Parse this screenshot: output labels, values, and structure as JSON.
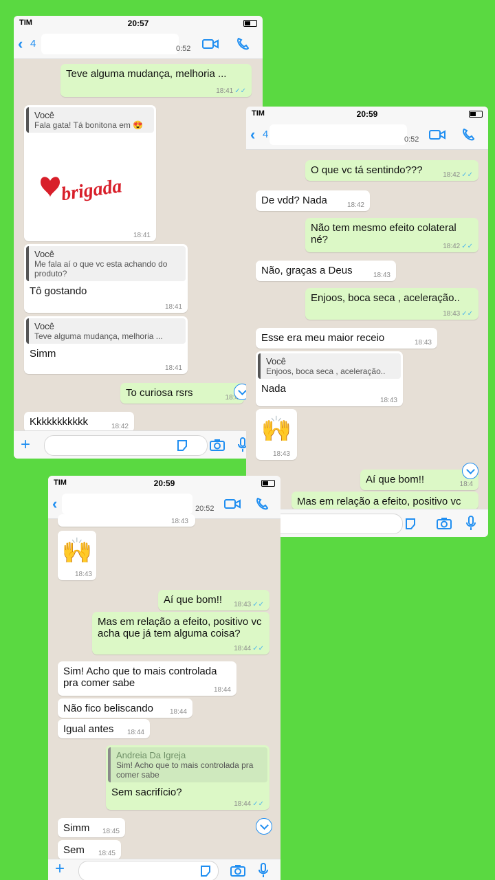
{
  "colors": {
    "background": "#5ad941",
    "outgoing": "#dcf8c6",
    "incoming": "#ffffff",
    "accent": "#1f8ef1"
  },
  "screen1": {
    "status": {
      "carrier": "TIM",
      "time": "20:57"
    },
    "header": {
      "back_count": "4",
      "last_seen": "0:52"
    },
    "messages": [
      {
        "text": "Teve alguma mudança, melhoria ...",
        "time": "18:41"
      },
      {
        "quote_name": "Você",
        "quote_text": "Fala gata! Tá bonitona em 😍",
        "sticker": "Obrigada",
        "time": "18:41"
      },
      {
        "quote_name": "Você",
        "quote_text": "Me fala aí o que vc esta achando do produto?",
        "text": "Tô gostando",
        "time": "18:41"
      },
      {
        "quote_name": "Você",
        "quote_text": "Teve alguma mudança, melhoria ...",
        "text": "Simm",
        "time": "18:41"
      },
      {
        "text": "To curiosa rsrs",
        "time": "18:4"
      },
      {
        "text": "Kkkkkkkkkkk",
        "time": "18:42"
      }
    ]
  },
  "screen2": {
    "status": {
      "carrier": "TIM",
      "time": "20:59"
    },
    "header": {
      "back_count": "4",
      "last_seen": "0:52"
    },
    "messages": [
      {
        "text": "O que vc tá sentindo???",
        "time": "18:42"
      },
      {
        "text": "De vdd? Nada",
        "time": "18:42"
      },
      {
        "text": "Não tem mesmo efeito colateral né?",
        "time": "18:42"
      },
      {
        "text": "Não, graças a Deus",
        "time": "18:43"
      },
      {
        "text": "Enjoos, boca seca , aceleração..",
        "time": "18:43"
      },
      {
        "text": "Esse era meu maior receio",
        "time": "18:43"
      },
      {
        "quote_name": "Você",
        "quote_text": "Enjoos, boca seca , aceleração..",
        "text": "Nada",
        "time": "18:43"
      },
      {
        "emoji": "🙌",
        "time": "18:43"
      },
      {
        "text": "Aí que bom!!",
        "time": "18:4"
      },
      {
        "text": "Mas em relação a efeito, positivo vc"
      }
    ]
  },
  "screen3": {
    "status": {
      "carrier": "TIM",
      "time": "20:59"
    },
    "header": {
      "last_seen": "20:52"
    },
    "messages": [
      {
        "time": "18:43"
      },
      {
        "emoji": "🙌",
        "time": "18:43"
      },
      {
        "text": "Aí que bom!!",
        "time": "18:43"
      },
      {
        "text": "Mas em relação a efeito, positivo vc acha que já tem alguma coisa?",
        "time": "18:44"
      },
      {
        "text": "Sim! Acho que to mais controlada pra comer sabe",
        "time": "18:44"
      },
      {
        "text": "Não fico beliscando",
        "time": "18:44"
      },
      {
        "text": "Igual antes",
        "time": "18:44"
      },
      {
        "quote_name": "Andreia Da Igreja",
        "quote_text": "Sim! Acho que to mais controlada pra comer sabe",
        "text": "Sem sacrifício?",
        "time": "18:44"
      },
      {
        "text": "Simm",
        "time": "18:45"
      },
      {
        "text": "Sem",
        "time": "18:45"
      }
    ]
  }
}
